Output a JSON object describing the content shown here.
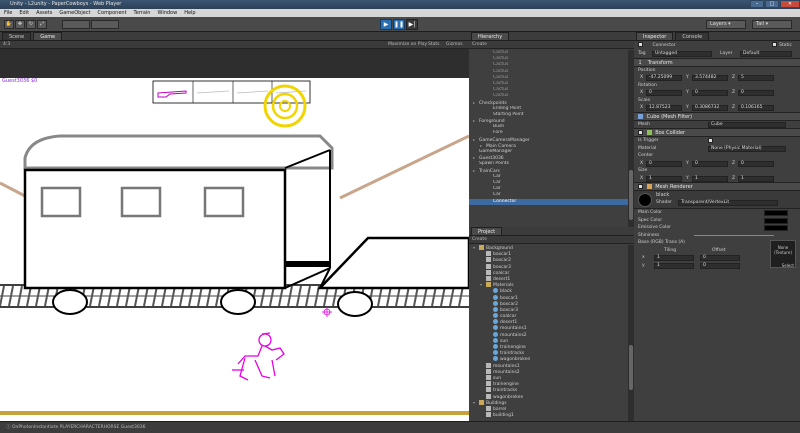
{
  "window": {
    "title": "Unity - L2unity - PaperCowboys - Web Player"
  },
  "menu": [
    "File",
    "Edit",
    "Assets",
    "GameObject",
    "Component",
    "Terrain",
    "Window",
    "Help"
  ],
  "toolbar": {
    "layers_label": "Layers",
    "layout_label": "Tall"
  },
  "scene_tab": "Scene",
  "game_tab": "Game",
  "game_subbar": {
    "left": "4:3",
    "maximize_on_play": "Maximize on Play",
    "stats": "Stats",
    "gizmos": "Gizmos"
  },
  "game": {
    "guest_label": "Guest3036  $0"
  },
  "hierarchy": {
    "tab": "Hierarchy",
    "create": "Create",
    "items": [
      {
        "label": "Cactus",
        "indent": 2,
        "state": "dim"
      },
      {
        "label": "Cactus",
        "indent": 2,
        "state": "dim"
      },
      {
        "label": "Cactus",
        "indent": 2,
        "state": "dim"
      },
      {
        "label": "Cactus",
        "indent": 2,
        "state": "dim"
      },
      {
        "label": "Cactus",
        "indent": 2,
        "state": "dim"
      },
      {
        "label": "Cactus",
        "indent": 2,
        "state": "dim"
      },
      {
        "label": "Cactus",
        "indent": 2,
        "state": "dim"
      },
      {
        "label": "Cactus",
        "indent": 2,
        "state": "dim"
      },
      {
        "label": "Checkpoints",
        "indent": 0,
        "state": "arrow"
      },
      {
        "label": "Ending Point",
        "indent": 2,
        "state": ""
      },
      {
        "label": "Starting Point",
        "indent": 2,
        "state": ""
      },
      {
        "label": "Foreground",
        "indent": 0,
        "state": "arrow"
      },
      {
        "label": "Bush",
        "indent": 2,
        "state": ""
      },
      {
        "label": "Fore",
        "indent": 2,
        "state": ""
      },
      {
        "label": "GameCameraManager",
        "indent": 0,
        "state": "arrow"
      },
      {
        "label": "Main Camera",
        "indent": 1,
        "state": "arrow"
      },
      {
        "label": "GameManager",
        "indent": 0,
        "state": ""
      },
      {
        "label": "Guest3036",
        "indent": 0,
        "state": "arrow"
      },
      {
        "label": "Spawn Points",
        "indent": 0,
        "state": ""
      },
      {
        "label": "TrainCars",
        "indent": 0,
        "state": "arrow"
      },
      {
        "label": "Car",
        "indent": 2,
        "state": ""
      },
      {
        "label": "Car",
        "indent": 2,
        "state": ""
      },
      {
        "label": "Car",
        "indent": 2,
        "state": ""
      },
      {
        "label": "Car",
        "indent": 2,
        "state": ""
      },
      {
        "label": "Connector",
        "indent": 2,
        "state": "sel"
      }
    ]
  },
  "project": {
    "tab": "Project",
    "create": "Create",
    "items": [
      {
        "label": "Background",
        "indent": 0,
        "type": "folder"
      },
      {
        "label": "boxcar1",
        "indent": 1,
        "type": "file"
      },
      {
        "label": "boxcar2",
        "indent": 1,
        "type": "file"
      },
      {
        "label": "boxcar3",
        "indent": 1,
        "type": "file"
      },
      {
        "label": "coalcar",
        "indent": 1,
        "type": "file"
      },
      {
        "label": "desert1",
        "indent": 1,
        "type": "file"
      },
      {
        "label": "Materials",
        "indent": 1,
        "type": "folder"
      },
      {
        "label": "black",
        "indent": 2,
        "type": "mat"
      },
      {
        "label": "boxcar1",
        "indent": 2,
        "type": "mat"
      },
      {
        "label": "boxcar2",
        "indent": 2,
        "type": "mat"
      },
      {
        "label": "boxcar3",
        "indent": 2,
        "type": "mat"
      },
      {
        "label": "coalcar",
        "indent": 2,
        "type": "mat"
      },
      {
        "label": "desert1",
        "indent": 2,
        "type": "mat"
      },
      {
        "label": "mountains1",
        "indent": 2,
        "type": "mat"
      },
      {
        "label": "mountains2",
        "indent": 2,
        "type": "mat"
      },
      {
        "label": "sun",
        "indent": 2,
        "type": "mat"
      },
      {
        "label": "trainengine",
        "indent": 2,
        "type": "mat"
      },
      {
        "label": "traintracks",
        "indent": 2,
        "type": "mat"
      },
      {
        "label": "wagonbroken",
        "indent": 2,
        "type": "mat"
      },
      {
        "label": "mountains1",
        "indent": 1,
        "type": "file"
      },
      {
        "label": "mountains2",
        "indent": 1,
        "type": "file"
      },
      {
        "label": "sun",
        "indent": 1,
        "type": "file"
      },
      {
        "label": "trainengine",
        "indent": 1,
        "type": "file"
      },
      {
        "label": "traintracks",
        "indent": 1,
        "type": "file"
      },
      {
        "label": "wagonbroken",
        "indent": 1,
        "type": "file"
      },
      {
        "label": "Buildings",
        "indent": 0,
        "type": "folder"
      },
      {
        "label": "barrel",
        "indent": 1,
        "type": "file"
      },
      {
        "label": "building1",
        "indent": 1,
        "type": "file"
      }
    ]
  },
  "inspector": {
    "tab": "Inspector",
    "console_tab": "Console",
    "object_name": "Connector",
    "static_label": "Static",
    "tag_label": "Tag",
    "tag_value": "Untagged",
    "layer_label": "Layer",
    "layer_value": "Default",
    "transform": {
      "header": "Transform",
      "position_label": "Position",
      "px": "-47.25099",
      "py": "3.574482",
      "pz": "5",
      "rotation_label": "Rotation",
      "rx": "0",
      "ry": "0",
      "rz": "0",
      "scale_label": "Scale",
      "sx": "12.87523",
      "sy": "0.3086732",
      "sz": "0.106165"
    },
    "mesh_filter": {
      "header": "Cube (Mesh Filter)",
      "mesh_label": "Mesh",
      "mesh_value": "Cube"
    },
    "box_collider": {
      "header": "Box Collider",
      "is_trigger": "Is Trigger",
      "material": "Material",
      "material_value": "None (Physic Material)",
      "center": "Center",
      "cx": "0",
      "cy": "0",
      "cz": "0",
      "size": "Size",
      "szx": "1",
      "szy": "1",
      "szz": "1"
    },
    "mesh_renderer": {
      "header": "Mesh Renderer"
    },
    "material": {
      "name": "black",
      "shader_label": "Shader",
      "shader_value": "Transparent/VertexLit",
      "main_color": "Main Color",
      "spec_color": "Spec Color",
      "emissive_color": "Emissive Color",
      "shininess": "Shininess",
      "base_label": "Base (RGB) Trans (A)",
      "tiling": "Tiling",
      "offset": "Offset",
      "x_label": "x",
      "y_label": "y",
      "tx": "1",
      "ty": "1",
      "ox": "0",
      "oy": "0",
      "none_texture": "None\n(Texture)",
      "select": "Select"
    }
  },
  "statusbar": {
    "text": "OnPhotonInstantiate PLAYERCHARACTERHORSE Guest3036"
  },
  "colors": {
    "accent_blue": "#3d6aa0",
    "play_blue": "#2b6fb3",
    "guest_purple": "#8a2be2",
    "horse_magenta": "#e600e6"
  }
}
